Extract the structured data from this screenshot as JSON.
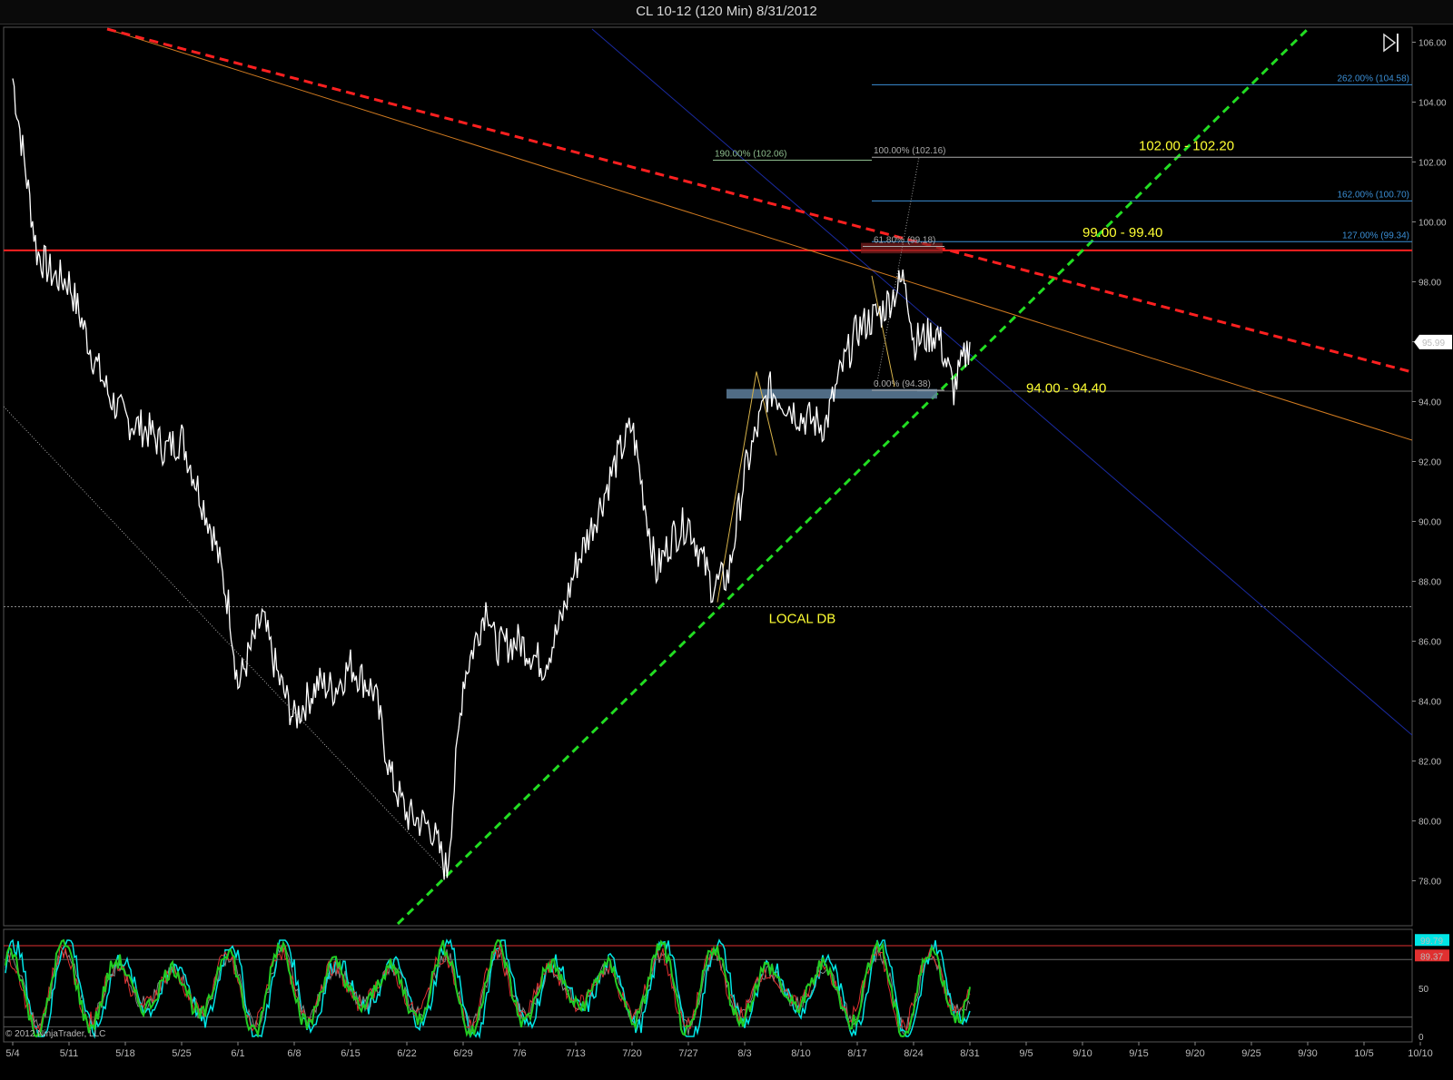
{
  "window": {
    "title": "CL 10-12 (120 Min)  8/31/2012"
  },
  "copyright": "© 2012 NinjaTrader, LLC",
  "icons": {
    "end_button": "skip-to-end-icon"
  },
  "colors": {
    "background": "#000000",
    "price": "#ffffff",
    "resistance_dashed": "#ff2020",
    "support_dashed": "#22dd22",
    "horizontal_red": "#ff2020",
    "blue_trend": "#1a2aa0",
    "orange_trend": "#d07a20",
    "fib_lines": "#3b8fd6",
    "annotation": "#ffff33",
    "price_badge": "#ffffff",
    "osc_cyan": "#00e5e5",
    "osc_green": "#22cc22",
    "osc_red": "#e03030",
    "osc_gray": "#888888"
  },
  "chart_data": [
    {
      "type": "line",
      "title": "CL 10-12 (120 Min)  8/31/2012",
      "ylim": [
        76.5,
        106.5
      ],
      "y_ticks": [
        "78.00",
        "80.00",
        "82.00",
        "84.00",
        "86.00",
        "88.00",
        "90.00",
        "92.00",
        "94.00",
        "96.00",
        "98.00",
        "100.00",
        "102.00",
        "104.00",
        "106.00"
      ],
      "x_ticks": [
        "5/4",
        "5/11",
        "5/18",
        "5/25",
        "6/1",
        "6/8",
        "6/15",
        "6/22",
        "6/29",
        "7/6",
        "7/13",
        "7/20",
        "7/27",
        "8/3",
        "8/10",
        "8/17",
        "8/24",
        "8/31",
        "9/5",
        "9/10",
        "9/15",
        "9/20",
        "9/25",
        "9/30",
        "10/5",
        "10/10"
      ],
      "last_price": "95.99",
      "series": [
        {
          "x": [
            "5/4",
            "5/7",
            "5/9",
            "5/11",
            "5/14",
            "5/16",
            "5/18",
            "5/21",
            "5/23",
            "5/25",
            "5/29",
            "5/31",
            "6/1",
            "6/4",
            "6/6",
            "6/8",
            "6/11",
            "6/13",
            "6/15",
            "6/18",
            "6/20",
            "6/22",
            "6/25",
            "6/27",
            "6/29",
            "7/2",
            "7/3",
            "7/6",
            "7/9",
            "7/11",
            "7/13",
            "7/16",
            "7/18",
            "7/20",
            "7/23",
            "7/25",
            "7/27",
            "7/30",
            "8/1",
            "8/3",
            "8/6",
            "8/8",
            "8/10",
            "8/13",
            "8/15",
            "8/17",
            "8/20",
            "8/22",
            "8/23",
            "8/24",
            "8/27",
            "8/29",
            "8/31"
          ],
          "values": [
            104.8,
            99.0,
            98.2,
            98.0,
            95.5,
            94.2,
            93.4,
            93.0,
            92.4,
            92.8,
            89.5,
            87.0,
            84.5,
            86.8,
            84.8,
            83.4,
            84.6,
            84.4,
            85.2,
            84.3,
            81.5,
            80.2,
            79.8,
            78.3,
            84.7,
            87.3,
            85.8,
            86.0,
            85.2,
            86.5,
            88.5,
            90.5,
            92.0,
            93.2,
            88.3,
            89.5,
            90.0,
            87.8,
            88.2,
            91.6,
            94.4,
            94.0,
            93.5,
            93.2,
            95.0,
            96.4,
            97.0,
            97.8,
            98.2,
            96.0,
            96.3,
            94.4,
            95.99
          ]
        }
      ],
      "levels": [
        {
          "label": "262.00% (104.58)",
          "value": 104.58
        },
        {
          "label": "190.00% (102.06)",
          "value": 102.06
        },
        {
          "label": "100.00% (102.16)",
          "value": 102.16
        },
        {
          "label": "162.00% (100.70)",
          "value": 100.7
        },
        {
          "label": "127.00% (99.34)",
          "value": 99.34
        },
        {
          "label": "61.80% (99.18)",
          "value": 99.18
        },
        {
          "label": "0.00% (94.38)",
          "value": 94.38
        }
      ],
      "annotations": [
        {
          "text": "102.00 - 102.20",
          "x": "9/15",
          "y": 102.4
        },
        {
          "text": "99.00 - 99.40",
          "x": "9/10",
          "y": 99.5
        },
        {
          "text": "94.00 - 94.40",
          "x": "9/5",
          "y": 94.3
        },
        {
          "text": "LOCAL DB",
          "x": "8/6",
          "y": 86.6
        }
      ]
    },
    {
      "type": "line",
      "ylim": [
        0,
        100
      ],
      "y_ticks": [
        "0",
        "50"
      ],
      "last_values": [
        "99.79",
        "89.37"
      ]
    }
  ]
}
